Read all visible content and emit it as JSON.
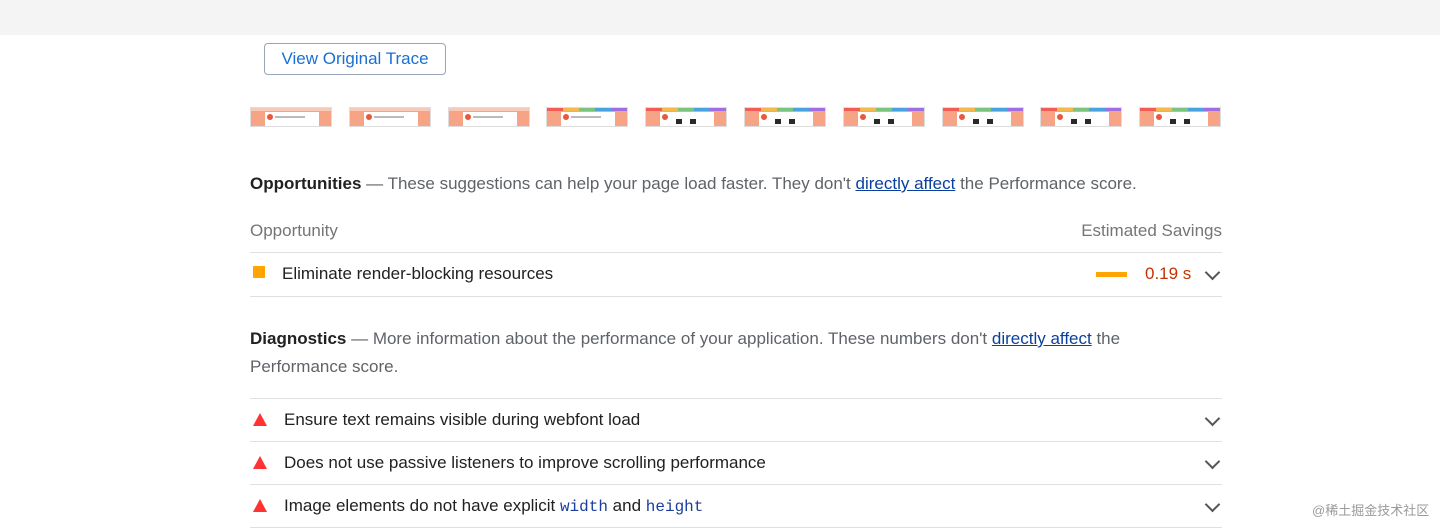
{
  "toolbar": {
    "view_trace_label": "View Original Trace"
  },
  "filmstrip": {
    "frame_count": 10
  },
  "opportunities": {
    "heading": "Opportunities",
    "dash": " — ",
    "desc": "These suggestions can help your page load faster. They don't ",
    "link": "directly affect",
    "desc_end": " the Performance score.",
    "col_left": "Opportunity",
    "col_right": "Estimated Savings",
    "items": [
      {
        "title": "Eliminate render-blocking resources",
        "savings": "0.19 s",
        "status": "average",
        "status_color": "#ffa400"
      }
    ]
  },
  "diagnostics": {
    "heading": "Diagnostics",
    "dash": " — ",
    "desc": "More information about the performance of your application. These numbers don't ",
    "link": "directly affect",
    "desc_end": " the Performance score.",
    "items": [
      {
        "title": "Ensure text remains visible during webfont load",
        "status": "fail",
        "status_color": "#ff3333"
      },
      {
        "title": "Does not use passive listeners to improve scrolling performance",
        "status": "fail",
        "status_color": "#ff3333"
      },
      {
        "title_prefix": "Image elements do not have explicit ",
        "code1": "width",
        "title_mid": " and ",
        "code2": "height",
        "status": "fail",
        "status_color": "#ff3333"
      }
    ]
  },
  "watermark": "@稀土掘金技术社区"
}
